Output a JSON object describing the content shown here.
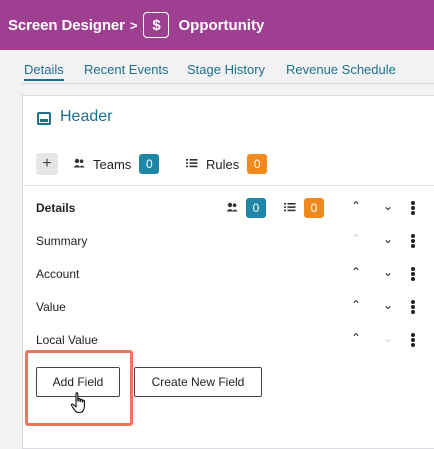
{
  "topbar": {
    "crumb": "Screen Designer",
    "separator": ">",
    "object_icon": "$",
    "object_name": "Opportunity"
  },
  "tabs": [
    {
      "label": "Details",
      "active": true
    },
    {
      "label": "Recent Events",
      "active": false
    },
    {
      "label": "Stage History",
      "active": false
    },
    {
      "label": "Revenue Schedule",
      "active": false
    }
  ],
  "section": {
    "title": "Header",
    "add_symbol": "+",
    "teams_label": "Teams",
    "teams_count": "0",
    "rules_label": "Rules",
    "rules_count": "0"
  },
  "fields": [
    {
      "label": "Details",
      "bold": true,
      "teams_count": "0",
      "rules_count": "0",
      "up_enabled": true,
      "down_enabled": true
    },
    {
      "label": "Summary",
      "bold": false,
      "up_enabled": false,
      "down_enabled": true
    },
    {
      "label": "Account",
      "bold": false,
      "up_enabled": true,
      "down_enabled": true
    },
    {
      "label": "Value",
      "bold": false,
      "up_enabled": true,
      "down_enabled": true
    },
    {
      "label": "Local Value",
      "bold": false,
      "up_enabled": true,
      "down_enabled": false
    }
  ],
  "buttons": {
    "add_field": "Add Field",
    "create_new_field": "Create New Field"
  },
  "colors": {
    "topbar": "#9e3f92",
    "accent": "#1f6f8b",
    "teams_badge": "#1d87a5",
    "rules_badge": "#f08a1c",
    "highlight": "#e8785b"
  },
  "icons": {
    "object": "dollar-icon",
    "section": "layout-icon",
    "teams": "people-icon",
    "rules": "list-icon",
    "move_up": "chevron-up-icon",
    "move_down": "chevron-down-icon",
    "more": "more-vertical-icon",
    "cursor": "hand-pointer-icon"
  }
}
